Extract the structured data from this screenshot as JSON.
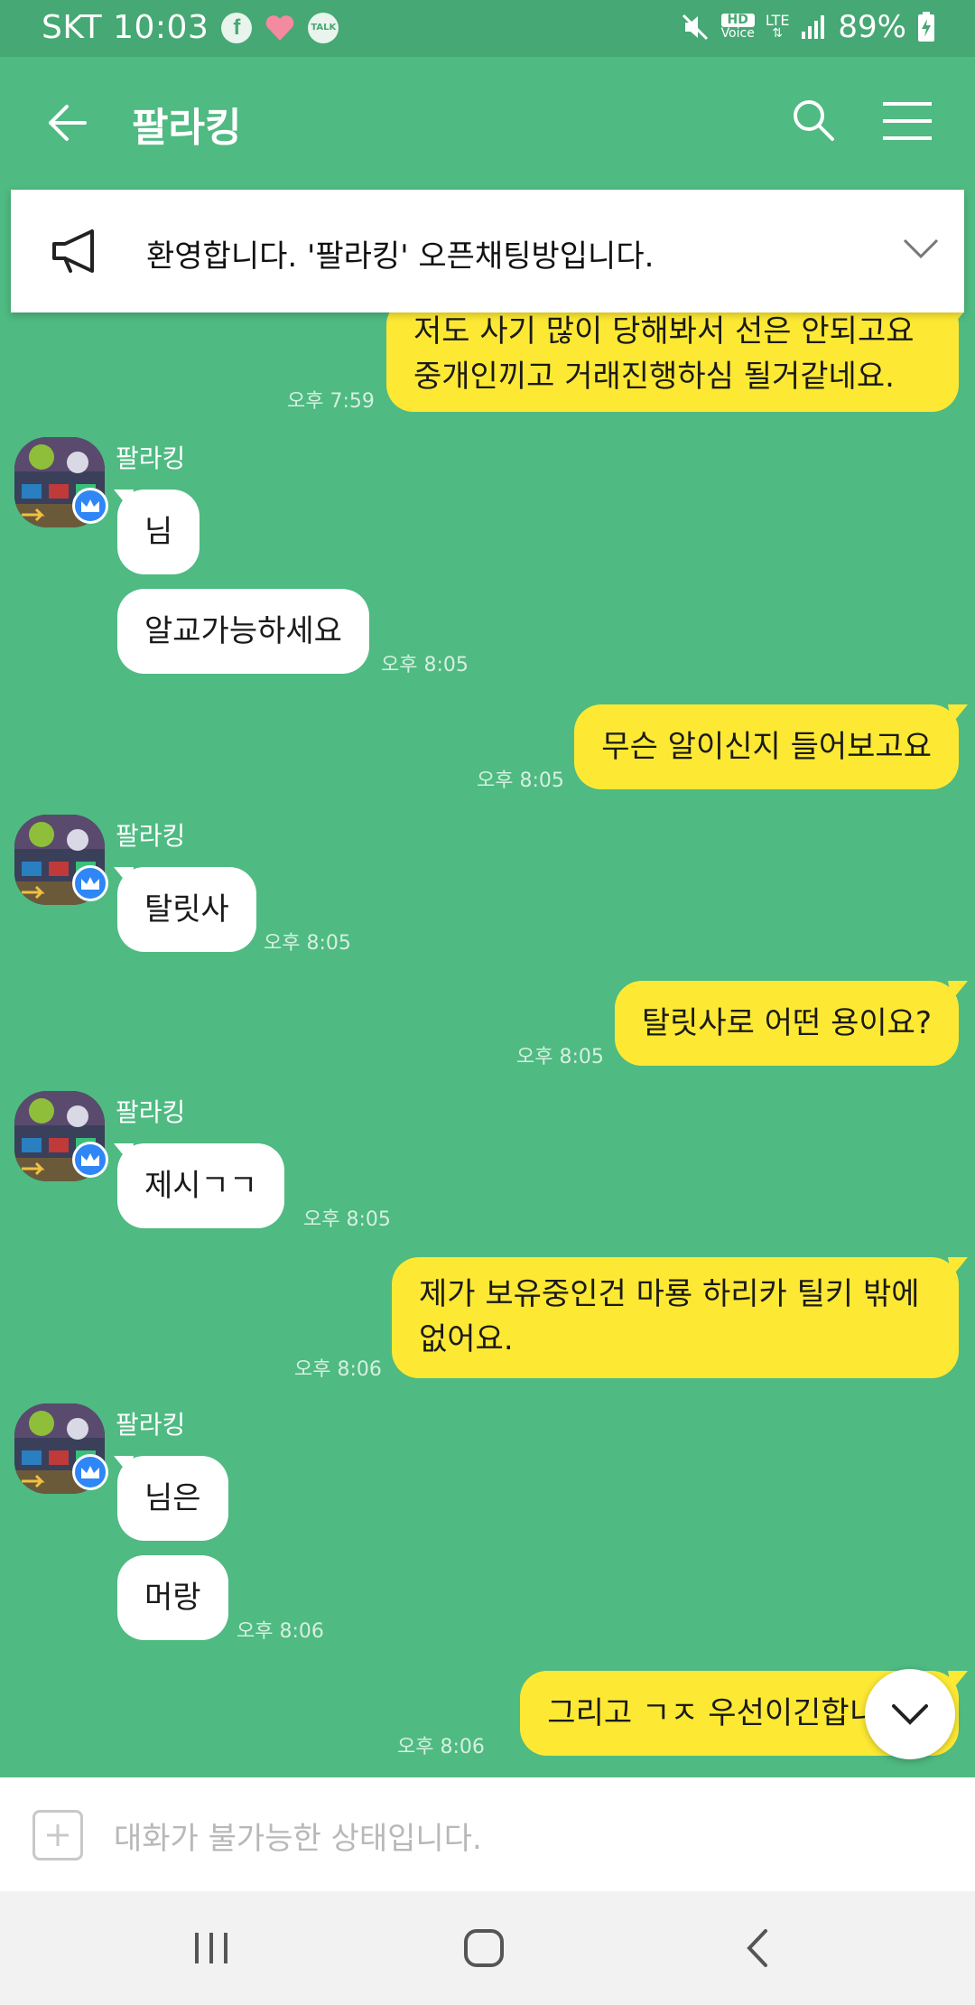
{
  "status_bar": {
    "carrier_time": "SKT 10:03",
    "notif_icons": [
      "facebook-icon",
      "heart-icon",
      "talk-icon"
    ],
    "talk_label": "TALK",
    "hd_label": "HD",
    "voice_label": "Voice",
    "lte_label": "LTE",
    "battery": "89%"
  },
  "header": {
    "title": "팔라킹"
  },
  "notice": {
    "text": "환영합니다. '팔라킹' 오픈채팅방입니다."
  },
  "messages": [
    {
      "from": "me",
      "text": "저도 사기 많이 당해봐서 선은 안되고요 중개인끼고 거래진행하심 될거같네요.",
      "time": "오후 7:59"
    },
    {
      "from": "them",
      "sender": "팔라킹",
      "text": "님",
      "time": ""
    },
    {
      "from": "them",
      "text": "알교가능하세요",
      "time": "오후 8:05"
    },
    {
      "from": "me",
      "text": "무슨 알이신지 들어보고요",
      "time": "오후 8:05"
    },
    {
      "from": "them",
      "sender": "팔라킹",
      "text": "탈릿사",
      "time": "오후 8:05"
    },
    {
      "from": "me",
      "text": "탈릿사로 어떤 용이요?",
      "time": "오후 8:05"
    },
    {
      "from": "them",
      "sender": "팔라킹",
      "text": "제시ㄱㄱ",
      "time": "오후 8:05"
    },
    {
      "from": "me",
      "text": "제가 보유중인건 마룡 하리카 틸키 밖에 없어요.",
      "time": "오후 8:06"
    },
    {
      "from": "them",
      "sender": "팔라킹",
      "text": "님은",
      "time": ""
    },
    {
      "from": "them",
      "text": "머랑",
      "time": "오후 8:06"
    },
    {
      "from": "me",
      "text": "그리고 ㄱㅈ 우선이긴합니",
      "time": "오후 8:06"
    }
  ],
  "input": {
    "placeholder": "대화가 불가능한 상태입니다."
  },
  "colors": {
    "chat_bg": "#4fba82",
    "status_bg": "#46a874",
    "my_bubble": "#fde933",
    "their_bubble": "#ffffff",
    "crown": "#2f86f6"
  }
}
